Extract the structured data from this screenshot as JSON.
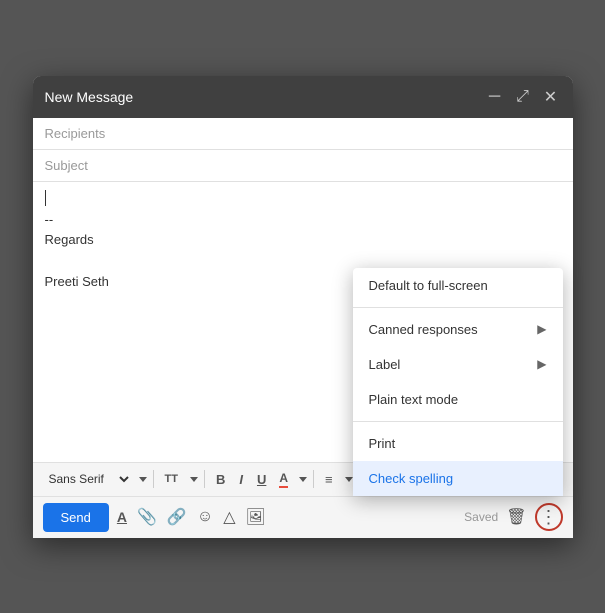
{
  "window": {
    "title": "New Message",
    "min_icon": "─",
    "expand_icon": "⤢",
    "close_icon": "✕"
  },
  "fields": {
    "recipients_placeholder": "Recipients",
    "subject_placeholder": "Subject"
  },
  "body": {
    "cursor_visible": true,
    "signature_line1": "--",
    "signature_line2": "Regards",
    "signature_line3": "",
    "signature_line4": "Preeti Seth"
  },
  "toolbar": {
    "font_family": "Sans Serif",
    "font_size_icon": "TT",
    "bold_label": "B",
    "italic_label": "I",
    "underline_label": "U",
    "font_color_label": "A",
    "align_label": "≡"
  },
  "bottom_bar": {
    "send_label": "Send",
    "saved_text": "Saved",
    "format_icon": "A",
    "attach_icon": "📎",
    "link_icon": "🔗",
    "emoji_icon": "☺",
    "drive_icon": "△",
    "photo_icon": "🖼",
    "trash_icon": "🗑",
    "more_icon": "⋮"
  },
  "dropdown": {
    "items": [
      {
        "label": "Default to full-screen",
        "has_arrow": false,
        "highlighted": false
      },
      {
        "label": "Canned responses",
        "has_arrow": true,
        "highlighted": false
      },
      {
        "label": "Label",
        "has_arrow": true,
        "highlighted": false
      },
      {
        "label": "Plain text mode",
        "has_arrow": false,
        "highlighted": false
      },
      {
        "label": "Print",
        "has_arrow": false,
        "highlighted": false
      },
      {
        "label": "Check spelling",
        "has_arrow": false,
        "highlighted": true
      }
    ]
  }
}
